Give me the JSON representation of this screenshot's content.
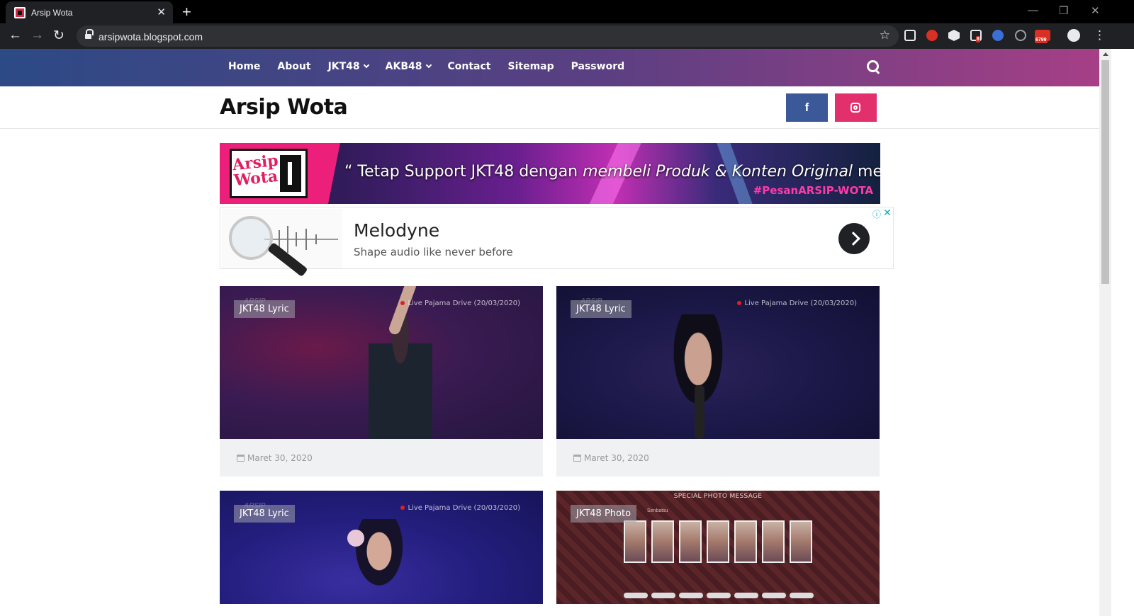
{
  "browser": {
    "tab_title": "Arsip Wota",
    "url": "arsipwota.blogspot.com",
    "extension_badges": {
      "mail": "6799",
      "counter": "8"
    }
  },
  "site": {
    "nav": [
      "Home",
      "About",
      "JKT48",
      "AKB48",
      "Contact",
      "Sitemap",
      "Password"
    ],
    "title": "Arsip Wota",
    "social": {
      "facebook_glyph": "f"
    }
  },
  "banner": {
    "logo_line1": "Arsip",
    "logo_line2": "Wota",
    "quote_a": "“ Tetap Support JKT48 dengan ",
    "quote_b": "membeli Produk & Konten Original",
    "quote_c": " mereka. ”",
    "hashtag": "#PesanARSIP-WOTA"
  },
  "ad": {
    "title": "Melodyne",
    "subtitle": "Shape audio like never before"
  },
  "posts": [
    {
      "label": "JKT48 Lyric",
      "date": "Maret 30, 2020",
      "overlay": "Live Pajama Drive (20/03/2020)",
      "watermark": "ARSIP"
    },
    {
      "label": "JKT48 Lyric",
      "date": "Maret 30, 2020",
      "overlay": "Live Pajama Drive (20/03/2020)",
      "watermark": "ARSIP"
    },
    {
      "label": "JKT48 Lyric",
      "overlay": "Live Pajama Drive (20/03/2020)",
      "watermark": "ARSIP"
    },
    {
      "label": "JKT48 Photo",
      "overlay": "SPECIAL PHOTO MESSAGE",
      "sub": "Senbatsu"
    }
  ],
  "colors": {
    "nav_gradient_start": "#2c4a86",
    "nav_gradient_end": "#a63f86",
    "facebook": "#3b5998",
    "instagram": "#e1306c",
    "banner_pink": "#ec1f7a"
  },
  "icons": [
    "back-icon",
    "forward-icon",
    "reload-icon",
    "lock-icon",
    "star-icon",
    "search-icon",
    "facebook-icon",
    "instagram-icon",
    "calendar-icon",
    "ad-info-icon",
    "ad-close-icon",
    "chevron-right-icon"
  ]
}
